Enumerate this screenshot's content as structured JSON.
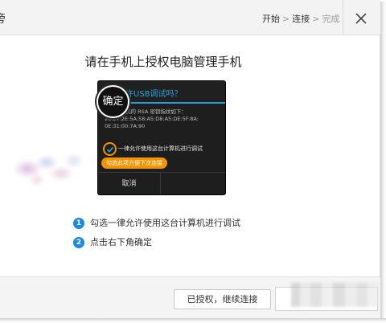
{
  "titlebar": {
    "title_fragment": "旁",
    "steps": [
      {
        "label": "开始",
        "state": "done"
      },
      {
        "label": "连接",
        "state": "current"
      },
      {
        "label": "完成",
        "state": "pending"
      }
    ],
    "step_separator": ">",
    "close_icon": "close-icon"
  },
  "main": {
    "heading": "请在手机上授权电脑管理手机"
  },
  "phone_dialog": {
    "icon": "usb-icon",
    "title": "允许USB调试吗？",
    "body_lines": [
      "这台计算机的 RSA 密钥指纹如下：",
      "26:27:2E:5A:58:A5:D8:A5:DE:5F:8A:",
      "0E:31:00:7A:90"
    ],
    "checkbox_label": "一律允许使用这台计算机进行调试",
    "tip": "勾选此项方便下次连接",
    "cancel_label": "取消",
    "ok_label": "确定",
    "accent": "#22a0d8",
    "highlight": "#f39400"
  },
  "instructions": [
    {
      "number": "1",
      "text": "勾选一律允许使用这台计算机进行调试"
    },
    {
      "number": "2",
      "text": "点击右下角确定"
    }
  ],
  "footer": {
    "authorized_button": "已授权，继续连接"
  },
  "colors": {
    "step_badge": "#1e88e5",
    "titlebar_bg": "#f3f3f3",
    "footer_bg": "#f4f4f4"
  }
}
